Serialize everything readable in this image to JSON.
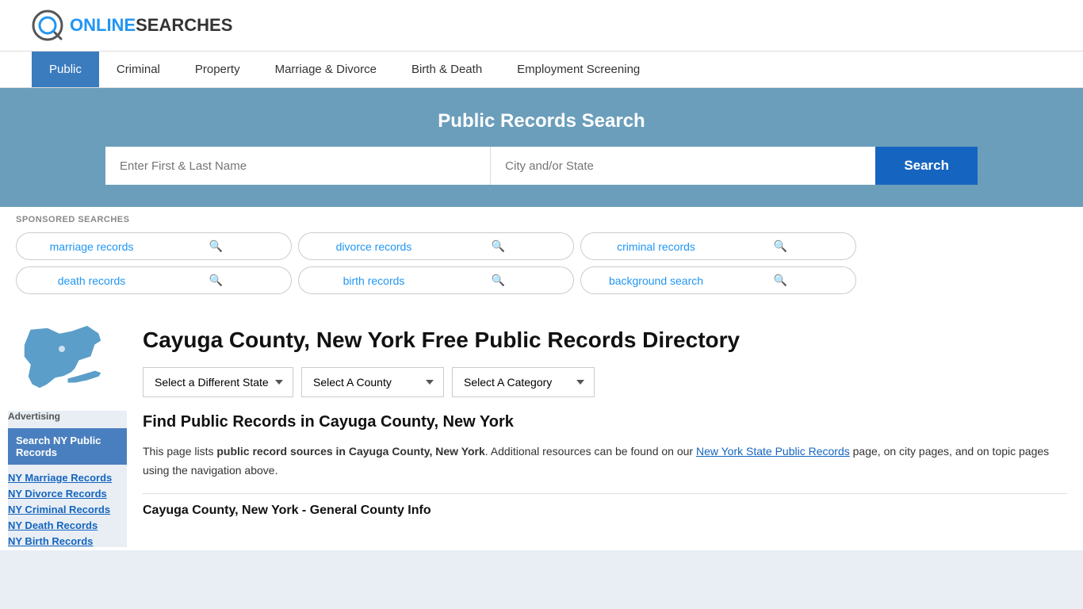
{
  "logo": {
    "text_online": "ONLINE",
    "text_searches": "SEARCHES"
  },
  "nav": {
    "items": [
      {
        "label": "Public",
        "active": true
      },
      {
        "label": "Criminal",
        "active": false
      },
      {
        "label": "Property",
        "active": false
      },
      {
        "label": "Marriage & Divorce",
        "active": false
      },
      {
        "label": "Birth & Death",
        "active": false
      },
      {
        "label": "Employment Screening",
        "active": false
      }
    ]
  },
  "search_banner": {
    "title": "Public Records Search",
    "name_placeholder": "Enter First & Last Name",
    "location_placeholder": "City and/or State",
    "button_label": "Search"
  },
  "sponsored": {
    "label": "SPONSORED SEARCHES",
    "items": [
      {
        "text": "marriage records"
      },
      {
        "text": "divorce records"
      },
      {
        "text": "criminal records"
      },
      {
        "text": "death records"
      },
      {
        "text": "birth records"
      },
      {
        "text": "background search"
      }
    ]
  },
  "page": {
    "title": "Cayuga County, New York Free Public Records Directory",
    "dropdowns": {
      "state": {
        "label": "Select a Different State",
        "options": [
          "Select a Different State"
        ]
      },
      "county": {
        "label": "Select A County",
        "options": [
          "Select A County"
        ]
      },
      "category": {
        "label": "Select A Category",
        "options": [
          "Select A Category"
        ]
      }
    },
    "section_heading": "Find Public Records in Cayuga County, New York",
    "description_1": "This page lists",
    "description_bold": "public record sources in Cayuga County, New York",
    "description_2": ". Additional resources can be found on our",
    "description_link": "New York State Public Records",
    "description_3": " page, on city pages, and on topic pages using the navigation above.",
    "general_info_heading": "Cayuga County, New York - General County Info"
  },
  "sidebar": {
    "advertising_label": "Advertising",
    "featured": {
      "label": "Search NY Public Records"
    },
    "links": [
      {
        "text": "NY Marriage Records"
      },
      {
        "text": "NY Divorce Records"
      },
      {
        "text": "NY Criminal Records"
      },
      {
        "text": "NY Death Records"
      },
      {
        "text": "NY Birth Records"
      }
    ]
  }
}
